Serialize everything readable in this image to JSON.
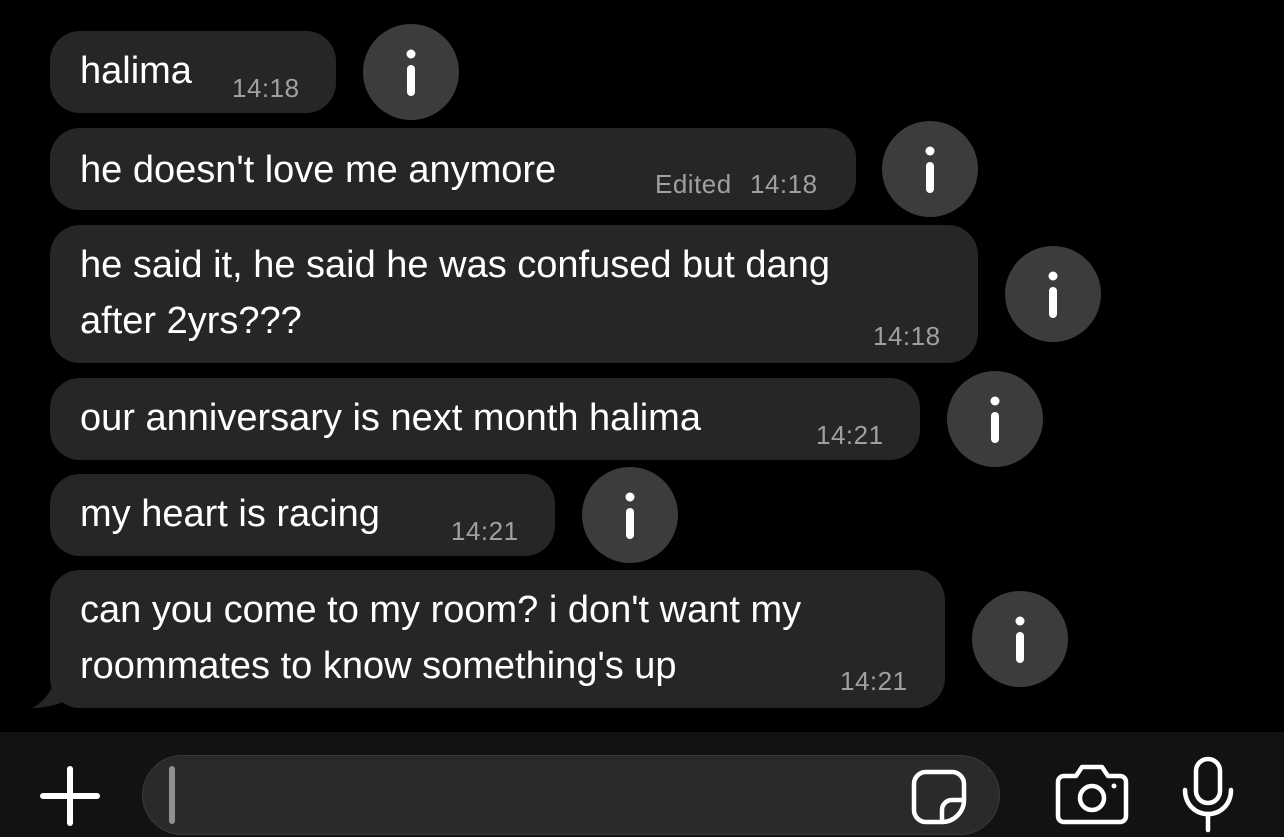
{
  "messages": [
    {
      "text_lines": [
        "halima"
      ],
      "time": "14:18",
      "edited": ""
    },
    {
      "text_lines": [
        "he doesn't love me anymore"
      ],
      "time": "14:18",
      "edited": "Edited"
    },
    {
      "text_lines": [
        "he said it, he said he was confused but dang",
        "after 2yrs???"
      ],
      "time": "14:18",
      "edited": ""
    },
    {
      "text_lines": [
        "our anniversary is next month halima"
      ],
      "time": "14:21",
      "edited": ""
    },
    {
      "text_lines": [
        "my heart is racing"
      ],
      "time": "14:21",
      "edited": ""
    },
    {
      "text_lines": [
        "can you come to my room? i don't want my",
        "roommates to know something's up"
      ],
      "time": "14:21",
      "edited": ""
    }
  ],
  "composer": {
    "input_value": "",
    "placeholder": ""
  },
  "icons": {
    "info": "info-icon",
    "add": "plus-icon",
    "sticker": "sticker-icon",
    "camera": "camera-icon",
    "microphone": "microphone-icon"
  },
  "colors": {
    "background": "#000000",
    "bubble": "#262626",
    "info_button": "#3c3c3e",
    "text": "#ffffff",
    "timestamp": "#a0a0a0",
    "composer_bar": "#121212"
  }
}
